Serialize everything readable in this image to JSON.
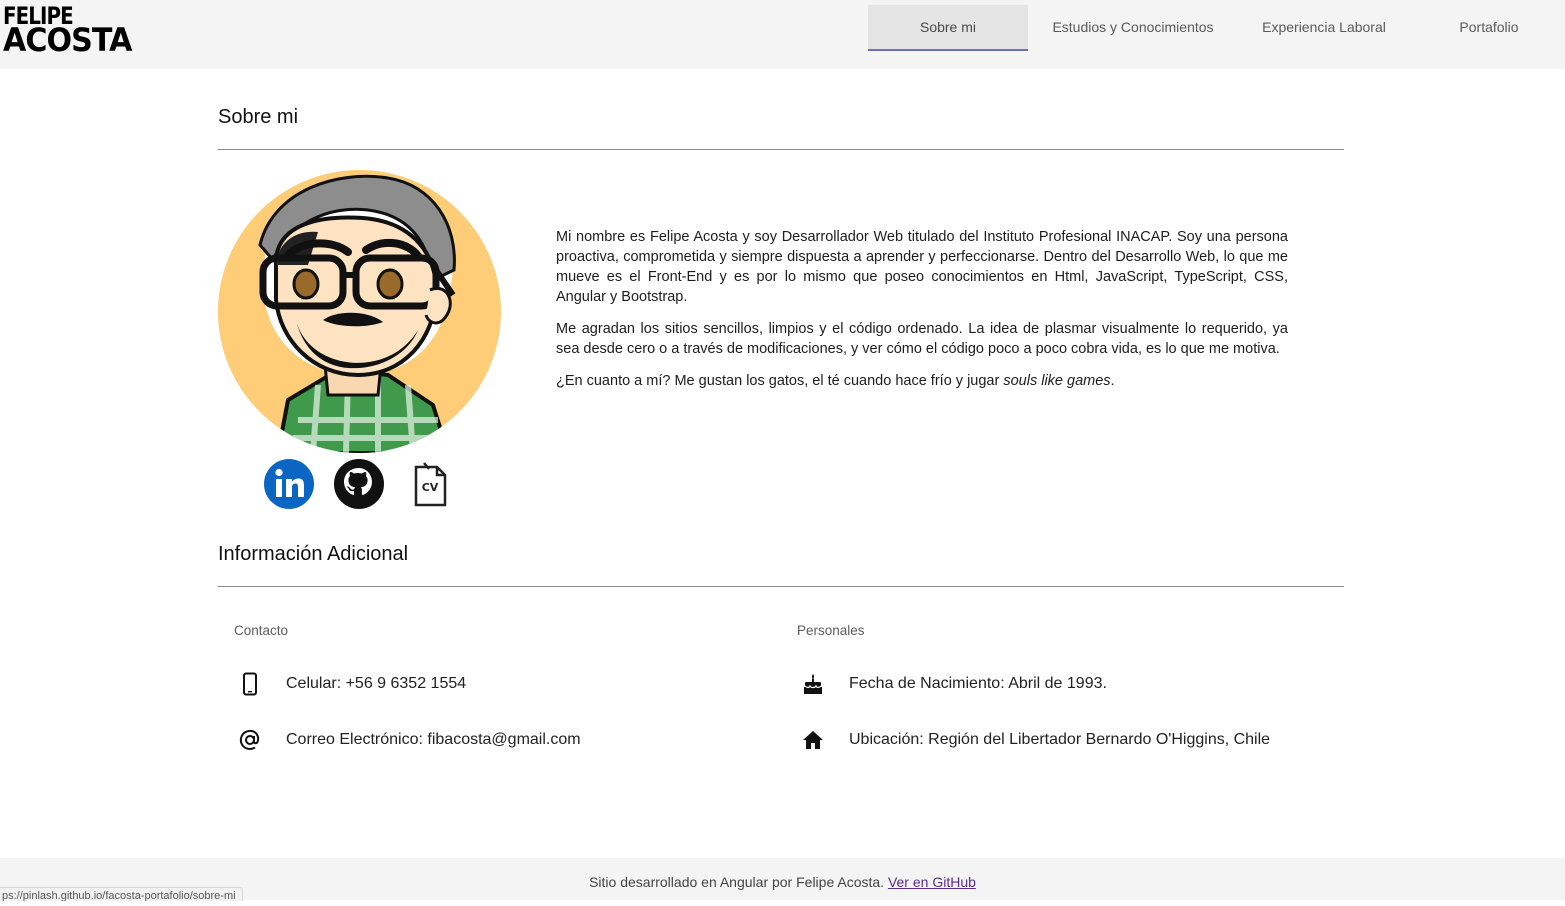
{
  "header": {
    "logo_line1": "FELIPE",
    "logo_line2": "ACOSTA",
    "tabs": [
      {
        "label": "Sobre mi",
        "active": true
      },
      {
        "label": "Estudios y Conocimientos",
        "active": false
      },
      {
        "label": "Experiencia Laboral",
        "active": false
      },
      {
        "label": "Portafolio",
        "active": false
      }
    ]
  },
  "about": {
    "title": "Sobre mi",
    "paragraph1": "Mi nombre es Felipe Acosta y soy Desarrollador Web titulado del Instituto Profesional INACAP. Soy una persona proactiva, comprometida y siempre dispuesta a aprender y perfeccionarse. Dentro del Desarrollo Web, lo que me mueve es el Front-End y es por lo mismo que poseo conocimientos en Html, JavaScript, TypeScript, CSS, Angular y Bootstrap.",
    "paragraph2": "Me agradan los sitios sencillos, limpios y el código ordenado. La idea de plasmar visualmente lo requerido, ya sea desde cero o a través de modificaciones, y ver cómo el código poco a poco cobra vida, es lo que me motiva.",
    "paragraph3_prefix": "¿En cuanto a mí? Me gustan los gatos, el té cuando hace frío y jugar ",
    "paragraph3_emphasis": "souls like games",
    "paragraph3_suffix": ".",
    "social": [
      {
        "icon": "linkedin-icon"
      },
      {
        "icon": "github-icon"
      },
      {
        "icon": "cv-icon",
        "text": "CV"
      }
    ]
  },
  "additional": {
    "title": "Información Adicional",
    "contact_heading": "Contacto",
    "personal_heading": "Personales",
    "contact": [
      {
        "icon": "phone-icon",
        "text": "Celular: +56 9 6352 1554"
      },
      {
        "icon": "at-icon",
        "text": "Correo Electrónico: fibacosta@gmail.com"
      }
    ],
    "personal": [
      {
        "icon": "cake-icon",
        "text": "Fecha de Nacimiento: Abril de 1993."
      },
      {
        "icon": "home-icon",
        "text": "Ubicación: Región del Libertador Bernardo O'Higgins, Chile"
      }
    ]
  },
  "footer": {
    "text": "Sitio desarrollado en Angular por Felipe Acosta. ",
    "link": "Ver en GitHub"
  },
  "status_url": "ps://pinlash.github.io/facosta-portafolio/sobre-mi",
  "colors": {
    "active_tab_underline": "#6b6fb3",
    "avatar_background": "#ffcc77",
    "linkedin_blue": "#0a66c2",
    "footer_link": "#5a2d8c"
  }
}
